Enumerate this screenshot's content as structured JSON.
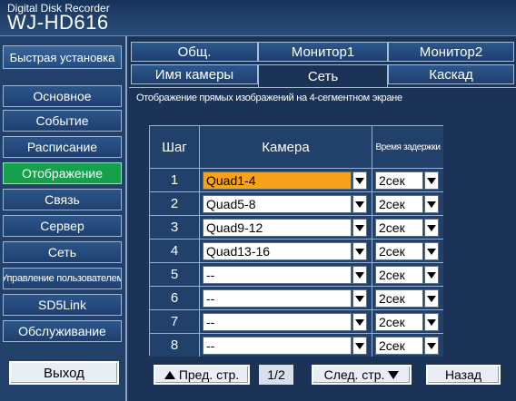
{
  "header": {
    "brand_sub": "Digital Disk Recorder",
    "brand_main": "WJ-HD616"
  },
  "sidebar": {
    "quick_setup": "Быстрая установка",
    "items": [
      {
        "label": "Основное",
        "active": false
      },
      {
        "label": "Событие",
        "active": false
      },
      {
        "label": "Расписание",
        "active": false
      },
      {
        "label": "Отображение",
        "active": true
      },
      {
        "label": "Связь",
        "active": false
      },
      {
        "label": "Сервер",
        "active": false
      },
      {
        "label": "Сеть",
        "active": false
      },
      {
        "label": "Управление пользователем",
        "active": false
      },
      {
        "label": "SD5Link",
        "active": false
      },
      {
        "label": "Обслуживание",
        "active": false
      }
    ],
    "exit": "Выход"
  },
  "tabs": {
    "row1": [
      "Общ.",
      "Монитор1",
      "Монитор2"
    ],
    "row2": [
      "Имя камеры",
      "Сеть",
      "Каскад"
    ],
    "active": "Сеть"
  },
  "section_title": "Отображение прямых изображений на 4-сегментном экране",
  "table": {
    "headers": {
      "step": "Шаг",
      "camera": "Камера",
      "delay": "Время задержки"
    },
    "rows": [
      {
        "step": "1",
        "camera": "Quad1-4",
        "delay": "2сек",
        "highlight": true
      },
      {
        "step": "2",
        "camera": "Quad5-8",
        "delay": "2сек",
        "highlight": false
      },
      {
        "step": "3",
        "camera": "Quad9-12",
        "delay": "2сек",
        "highlight": false
      },
      {
        "step": "4",
        "camera": "Quad13-16",
        "delay": "2сек",
        "highlight": false
      },
      {
        "step": "5",
        "camera": "--",
        "delay": "2сек",
        "highlight": false
      },
      {
        "step": "6",
        "camera": "--",
        "delay": "2сек",
        "highlight": false
      },
      {
        "step": "7",
        "camera": "--",
        "delay": "2сек",
        "highlight": false
      },
      {
        "step": "8",
        "camera": "--",
        "delay": "2сек",
        "highlight": false
      }
    ]
  },
  "pager": {
    "prev": "Пред. стр.",
    "indicator": "1/2",
    "next": "След. стр.",
    "back": "Назад"
  },
  "colors": {
    "active_green": "#16a04b",
    "selected_orange": "#f7a21b",
    "background_navy": "#1b3357"
  }
}
